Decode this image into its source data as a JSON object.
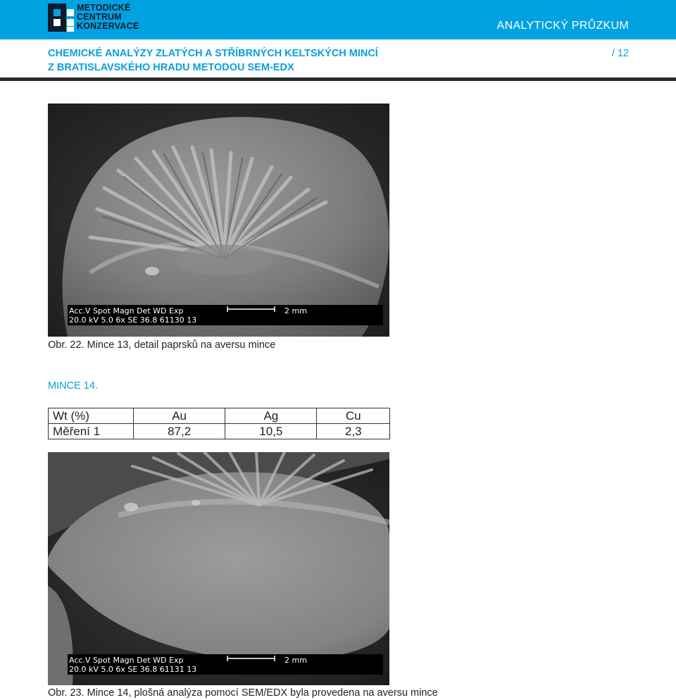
{
  "header": {
    "logo_lines": [
      "METODICKÉ",
      "CENTRUM",
      "KONZERVACE"
    ],
    "section_label": "ANALYTICKÝ PRŮZKUM",
    "title_lines": [
      "CHEMICKÉ ANALÝZY ZLATÝCH A STŘÍBRNÝCH KELTSKÝCH MINCÍ",
      "Z BRATISLAVSKÉHO HRADU METODOU SEM-EDX"
    ],
    "page_number": "/ 12"
  },
  "figure1": {
    "caption": "Obr. 22. Mince 13, detail paprsků na aversu mince",
    "databar": {
      "labels": "Acc.V   Spot Magn     Det   WD   Exp",
      "values": "20.0 kV 5.0    6x        SE   36.8  61130   13",
      "scale": "2 mm"
    }
  },
  "coin_heading": "MINCE 14.",
  "table": {
    "headers": [
      "Wt (%)",
      "Au",
      "Ag",
      "Cu"
    ],
    "rows": [
      [
        "Měření 1",
        "87,2",
        "10,5",
        "2,3"
      ]
    ]
  },
  "figure2": {
    "caption": "Obr. 23. Mince 14, plošná analýza pomocí SEM/EDX byla provedena na aversu mince",
    "databar": {
      "labels": "Acc.V   Spot Magn     Det   WD   Exp",
      "values": "20.0 kV 5.0    6x        SE   36.8  61131   13",
      "scale": "2 mm"
    }
  },
  "colors": {
    "brand_blue": "#00a2e2",
    "title_blue": "#0ba0d8",
    "rule": "#2a2a2a"
  }
}
